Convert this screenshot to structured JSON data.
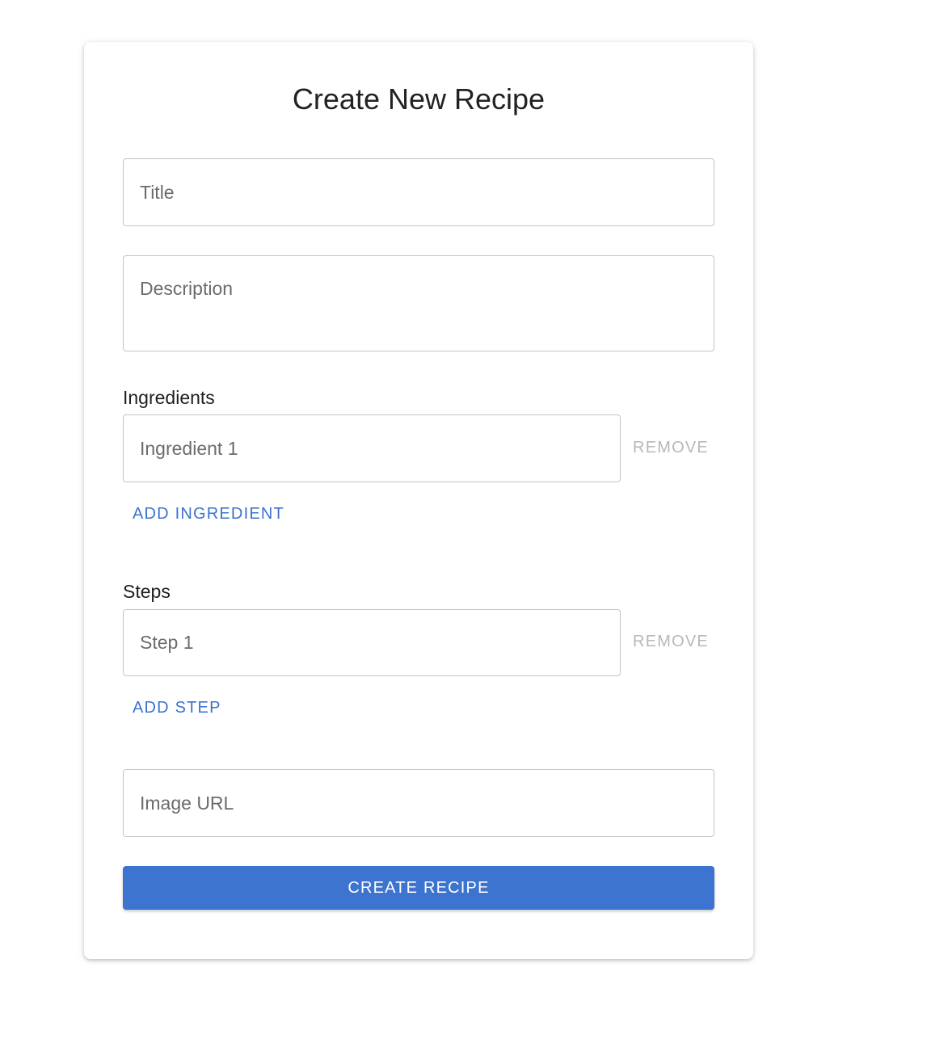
{
  "form": {
    "title": "Create New Recipe",
    "title_field": {
      "placeholder": "Title",
      "value": ""
    },
    "description_field": {
      "placeholder": "Description",
      "value": ""
    },
    "ingredients": {
      "label": "Ingredients",
      "items": [
        {
          "placeholder": "Ingredient 1",
          "value": "",
          "remove_label": "REMOVE"
        }
      ],
      "add_label": "ADD INGREDIENT"
    },
    "steps": {
      "label": "Steps",
      "items": [
        {
          "placeholder": "Step 1",
          "value": "",
          "remove_label": "REMOVE"
        }
      ],
      "add_label": "ADD STEP"
    },
    "image_url_field": {
      "placeholder": "Image URL",
      "value": ""
    },
    "submit_label": "CREATE RECIPE"
  },
  "colors": {
    "accent": "#3d74cf",
    "link": "#3b73cf",
    "disabled": "#b8b8b8",
    "border": "#c4c4c4"
  }
}
